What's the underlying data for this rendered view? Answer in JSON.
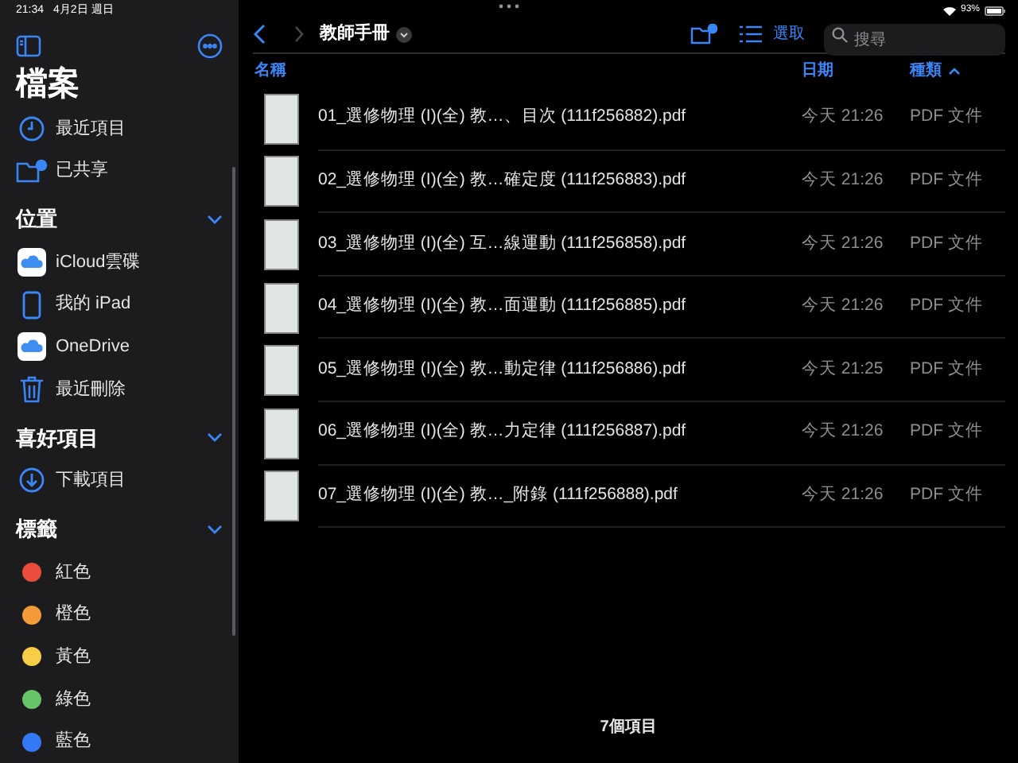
{
  "status_bar": {
    "time": "21:34",
    "date": "4月2日 週日",
    "battery_text": "93%"
  },
  "sidebar": {
    "title": "檔案",
    "sections": [
      {
        "items": [
          {
            "label": "最近項目",
            "kind": "recent"
          },
          {
            "label": "已共享",
            "kind": "shared"
          }
        ]
      },
      {
        "title": "位置",
        "expanded": true,
        "items": [
          {
            "label": "iCloud雲碟",
            "kind": "cloud"
          },
          {
            "label": "我的 iPad",
            "kind": "device"
          },
          {
            "label": "OneDrive",
            "kind": "cloud"
          },
          {
            "label": "最近刪除",
            "kind": "trash"
          }
        ]
      },
      {
        "title": "喜好項目",
        "expanded": true,
        "items": [
          {
            "label": "下載項目",
            "kind": "download"
          }
        ]
      },
      {
        "title": "標籤",
        "expanded": true,
        "items": [
          {
            "label": "紅色",
            "kind": "tag",
            "color": "#eb4d3d"
          },
          {
            "label": "橙色",
            "kind": "tag",
            "color": "#f19a37"
          },
          {
            "label": "黃色",
            "kind": "tag",
            "color": "#f7ce46"
          },
          {
            "label": "綠色",
            "kind": "tag",
            "color": "#65c466"
          },
          {
            "label": "藍色",
            "kind": "tag",
            "color": "#3478f6"
          }
        ]
      }
    ]
  },
  "toolbar": {
    "folder_title": "教師手冊",
    "select_label": "選取",
    "search": {
      "placeholder": "搜尋"
    }
  },
  "table": {
    "columns": [
      {
        "label": "名稱",
        "sorted": false
      },
      {
        "label": "日期",
        "sorted": false
      },
      {
        "label": "種類",
        "sorted": true
      }
    ],
    "rows": [
      {
        "name": "01_選修物理 (I)(全) 教…、目次 (111f256882).pdf",
        "date": "今天 21:26",
        "kind": "PDF 文件"
      },
      {
        "name": "02_選修物理 (I)(全) 教…確定度 (111f256883).pdf",
        "date": "今天 21:26",
        "kind": "PDF 文件"
      },
      {
        "name": "03_選修物理 (I)(全) 互…線運動 (111f256858).pdf",
        "date": "今天 21:26",
        "kind": "PDF 文件"
      },
      {
        "name": "04_選修物理 (I)(全) 教…面運動 (111f256885).pdf",
        "date": "今天 21:26",
        "kind": "PDF 文件"
      },
      {
        "name": "05_選修物理 (I)(全) 教…動定律 (111f256886).pdf",
        "date": "今天 21:25",
        "kind": "PDF 文件"
      },
      {
        "name": "06_選修物理 (I)(全) 教…力定律 (111f256887).pdf",
        "date": "今天 21:26",
        "kind": "PDF 文件"
      },
      {
        "name": "07_選修物理 (I)(全) 教…_附錄 (111f256888).pdf",
        "date": "今天 21:26",
        "kind": "PDF 文件"
      }
    ]
  },
  "footer": {
    "item_count": "7個項目"
  }
}
